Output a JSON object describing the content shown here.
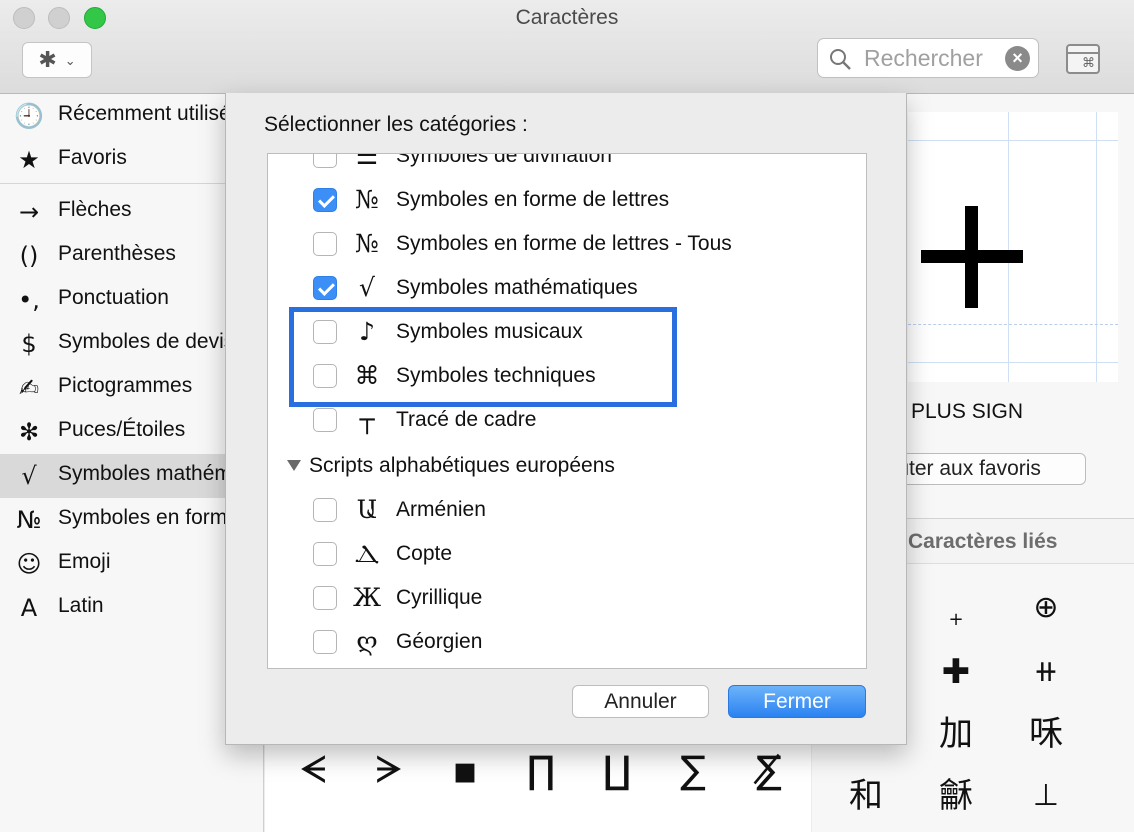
{
  "window": {
    "title": "Caractères"
  },
  "toolbar": {
    "gear_icon": "gear-icon",
    "gear_glyph": "✱",
    "chevron_glyph": "⌄",
    "search_placeholder": "Rechercher",
    "search_value": "",
    "clear_glyph": "×",
    "viewer_glyph": "⌘"
  },
  "sidebar": {
    "items": [
      {
        "icon": "🕘",
        "label": "Récemment utilisés"
      },
      {
        "icon": "★",
        "label": "Favoris"
      },
      {
        "icon": "→",
        "label": "Flèches"
      },
      {
        "icon": "()",
        "label": "Parenthèses"
      },
      {
        "icon": "•,",
        "label": "Ponctuation"
      },
      {
        "icon": "$",
        "label": "Symboles de devise"
      },
      {
        "icon": "✍",
        "label": "Pictogrammes"
      },
      {
        "icon": "✻",
        "label": "Puces/Étoiles"
      },
      {
        "icon": "√",
        "label": "Symboles mathématiques"
      },
      {
        "icon": "№",
        "label": "Symboles en forme de lettres"
      },
      {
        "icon": "☺",
        "label": "Emoji"
      },
      {
        "icon": "A",
        "label": "Latin"
      }
    ],
    "selected_index": 8
  },
  "sheet": {
    "title": "Sélectionner les catégories :",
    "rows": [
      {
        "checked": false,
        "icon": "☰",
        "label": "Symboles de divination"
      },
      {
        "checked": true,
        "icon": "№",
        "label": "Symboles en forme de lettres"
      },
      {
        "checked": false,
        "icon": "№",
        "label": "Symboles en forme de lettres - Tous"
      },
      {
        "checked": true,
        "icon": "√",
        "label": "Symboles mathématiques"
      },
      {
        "checked": false,
        "icon": "♪",
        "label": "Symboles musicaux"
      },
      {
        "checked": false,
        "icon": "⌘",
        "label": "Symboles techniques"
      },
      {
        "checked": false,
        "icon": "┬",
        "label": "Tracé de cadre"
      }
    ],
    "group": {
      "label": "Scripts alphabétiques européens",
      "expanded": true
    },
    "group_rows": [
      {
        "checked": false,
        "icon": "Ա",
        "label": "Arménien"
      },
      {
        "checked": false,
        "icon": "Ⲇ",
        "label": "Copte"
      },
      {
        "checked": false,
        "icon": "Ж",
        "label": "Cyrillique"
      },
      {
        "checked": false,
        "icon": "ღ",
        "label": "Géorgien"
      }
    ],
    "cancel_label": "Annuler",
    "close_label": "Fermer",
    "highlight_color": "#2a6fe0"
  },
  "detail": {
    "char_name": "PLUS SIGN",
    "add_favorites_label": "Ajouter aux favoris",
    "related_header": "Caractères liés",
    "related": [
      "+",
      "⊕",
      "✚",
      "⧺",
      "加",
      "咊",
      "和",
      "龢",
      "⊥"
    ]
  },
  "grid": {
    "cells": [
      "ᗕ",
      "ᗒ",
      "▪",
      "∏",
      "∐",
      "∑",
      "∑̸"
    ]
  },
  "colors": {
    "accent": "#3b8ff6",
    "zoom_button": "#33c748"
  }
}
